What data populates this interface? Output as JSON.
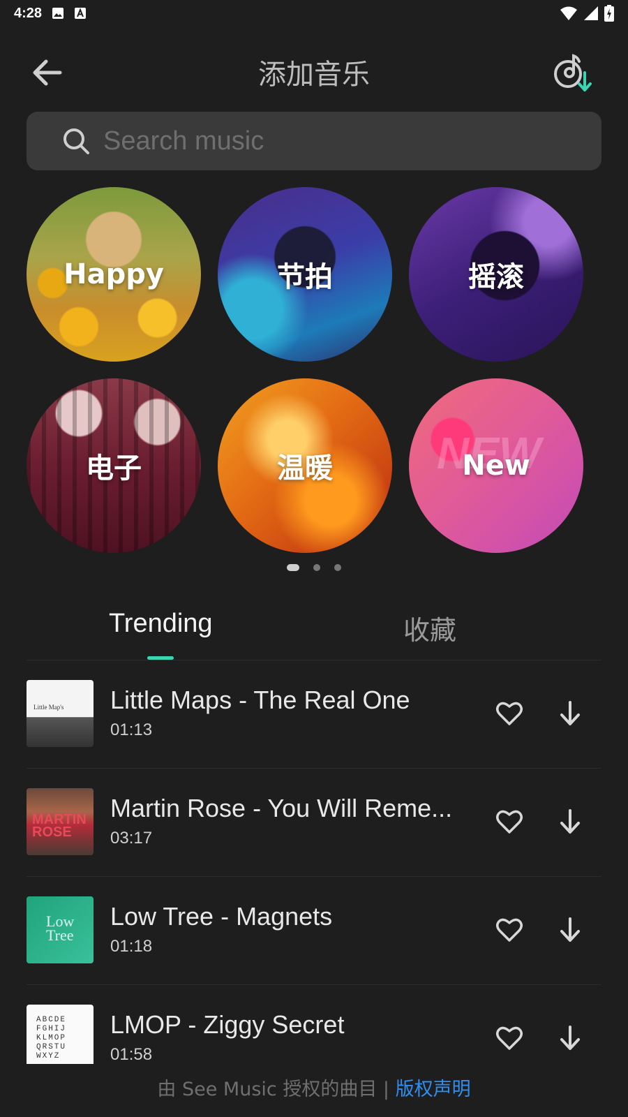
{
  "status_bar": {
    "time": "4:28",
    "left_icons": [
      "image-icon",
      "a-box-icon"
    ],
    "right_icons": [
      "wifi-icon",
      "signal-icon",
      "battery-icon"
    ]
  },
  "header": {
    "title": "添加音乐",
    "back_icon": "arrow-left-icon",
    "downloads_icon": "music-download-icon"
  },
  "search": {
    "placeholder": "Search music",
    "value": ""
  },
  "genres": [
    {
      "label": "Happy"
    },
    {
      "label": "节拍"
    },
    {
      "label": "摇滚"
    },
    {
      "label": "电子"
    },
    {
      "label": "温暖"
    },
    {
      "label": "New"
    }
  ],
  "pager": {
    "pages": 3,
    "active": 1
  },
  "tabs": [
    {
      "label": "Trending",
      "active": true
    },
    {
      "label": "收藏",
      "active": false
    }
  ],
  "tracks": [
    {
      "title": "Little Maps - The Real One",
      "duration": "01:13",
      "cover_text": "Little Map's"
    },
    {
      "title": "Martin Rose - You Will Reme...",
      "duration": "03:17",
      "cover_text": "MARTIN ROSE"
    },
    {
      "title": "Low Tree - Magnets",
      "duration": "01:18",
      "cover_text": "Low Tree"
    },
    {
      "title": "LMOP - Ziggy Secret",
      "duration": "01:58",
      "cover_text": "ABCDE FGHIJ KLMOP QRSTU WXYZ"
    }
  ],
  "footer": {
    "text": "由 See Music 授权的曲目 | ",
    "link": "版权声明"
  },
  "colors": {
    "background": "#1e1e1e",
    "accent": "#3ad6b4",
    "link": "#2f8ff0"
  }
}
